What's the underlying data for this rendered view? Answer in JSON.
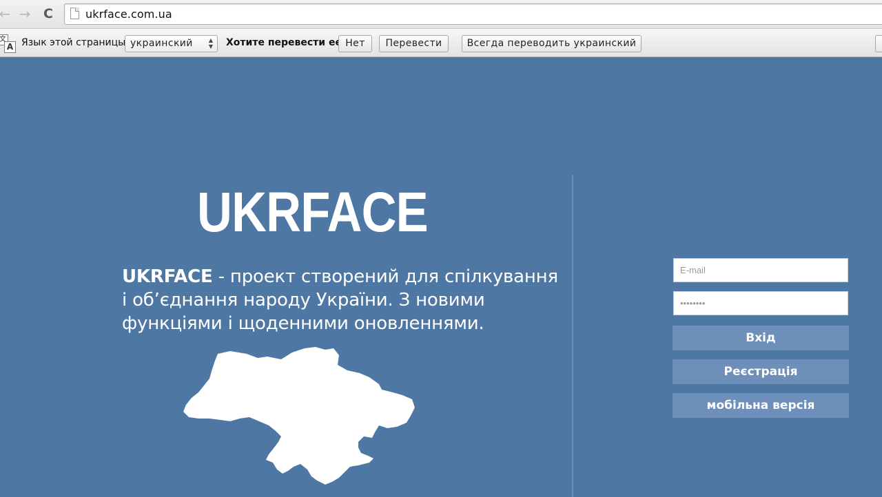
{
  "browser": {
    "back_icon": "←",
    "forward_icon": "→",
    "reload_icon": "C",
    "url": "ukrface.com.ua"
  },
  "translate_bar": {
    "icon_glyph_1": "文",
    "icon_glyph_2": "A",
    "language_label": "Язык этой страницы",
    "language_value": "украинский",
    "question": "Хотите перевести ее?",
    "no_button": "Нет",
    "translate_button": "Перевести",
    "always_button": "Всегда переводить украинский"
  },
  "page": {
    "logo": "UKRFACE",
    "description_brand": "UKRFACE",
    "description_line1": " - проект створений для спілкування",
    "description_line2": "і об’єднання народу України. З новими",
    "description_line3": "функціями і щоденними оновленнями."
  },
  "login": {
    "email_placeholder": "E-mail",
    "password_value": "••••••••",
    "login_button": "Вхід",
    "register_button": "Реєстрація",
    "mobile_button": "мобільна версія"
  },
  "colors": {
    "background": "#4f77a3",
    "button": "#6d8fb9"
  }
}
